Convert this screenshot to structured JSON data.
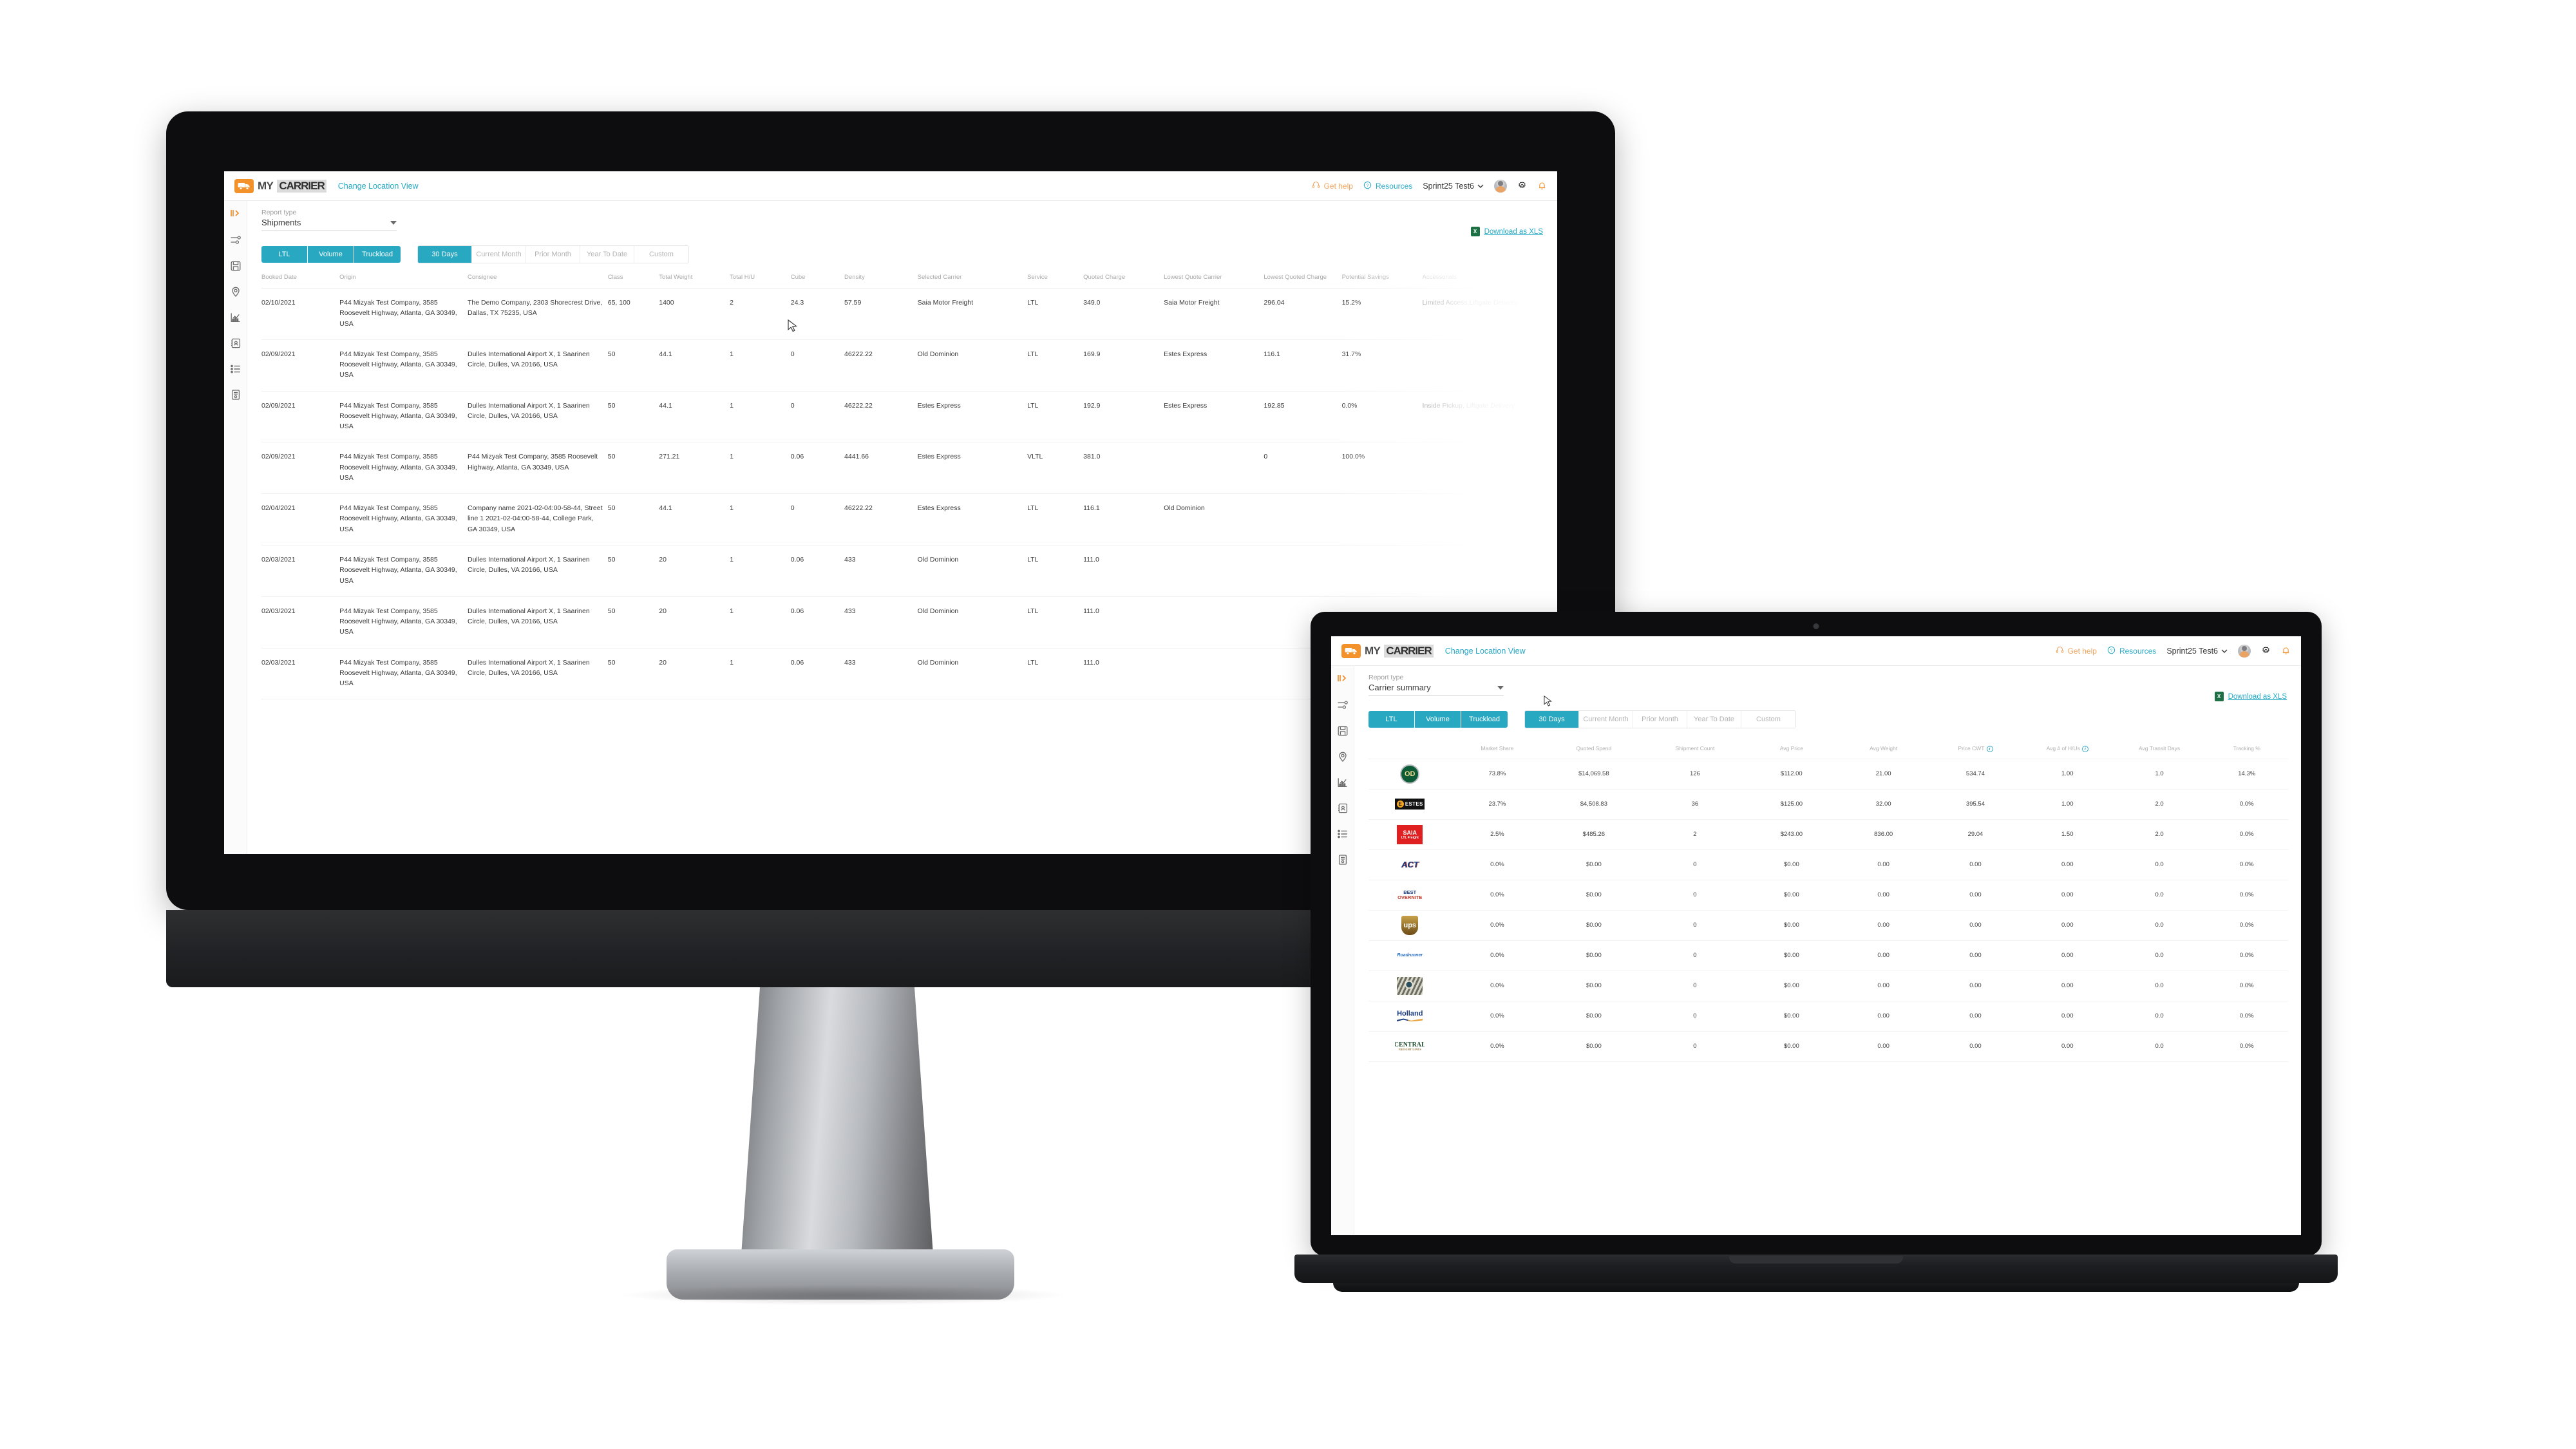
{
  "brand": {
    "my": "MY",
    "carrier": "CARRIER",
    "truck_icon": "truck-icon"
  },
  "topbar": {
    "change_location": "Change Location View",
    "get_help": "Get help",
    "resources": "Resources",
    "user": "Sprint25 Test6",
    "icons": [
      "headset-icon",
      "question-bubble-icon",
      "chevron-down-icon",
      "avatar",
      "gear-icon",
      "bell-icon"
    ]
  },
  "sidebar": {
    "items": [
      {
        "name": "expand-panel-icon",
        "glyph": "expand"
      },
      {
        "name": "filters-sliders-icon",
        "glyph": "sliders"
      },
      {
        "name": "save-disk-icon",
        "glyph": "disk"
      },
      {
        "name": "location-pin-icon",
        "glyph": "pin"
      },
      {
        "name": "analytics-chart-icon",
        "glyph": "chart"
      },
      {
        "name": "address-book-icon",
        "glyph": "book"
      },
      {
        "name": "list-icon",
        "glyph": "list"
      },
      {
        "name": "document-icon",
        "glyph": "doc"
      }
    ]
  },
  "desktop": {
    "report_type_label": "Report type",
    "report_type_value": "Shipments",
    "download_label": "Download as XLS",
    "download_icon": "xls-icon",
    "mode_tabs": [
      "LTL",
      "Volume",
      "Truckload"
    ],
    "range_tabs": [
      {
        "label": "30 Days",
        "active": true
      },
      {
        "label": "Current Month",
        "active": false
      },
      {
        "label": "Prior Month",
        "active": false
      },
      {
        "label": "Year To Date",
        "active": false
      },
      {
        "label": "Custom",
        "active": false
      }
    ],
    "columns": [
      "Booked Date",
      "Origin",
      "Consignee",
      "Class",
      "Total Weight",
      "Total H/U",
      "Cube",
      "Density",
      "Selected Carrier",
      "Service",
      "Quoted Charge",
      "Lowest Quote Carrier",
      "Lowest Quoted Charge",
      "Potential Savings",
      "Accessorials"
    ],
    "rows": [
      {
        "booked_date": "02/10/2021",
        "origin": "P44 Mizyak Test Company, 3585 Roosevelt Highway, Atlanta, GA 30349, USA",
        "consignee": "The Demo Company, 2303 Shorecrest Drive, Dallas, TX 75235, USA",
        "class": "65, 100",
        "total_weight": "1400",
        "total_hu": "2",
        "cube": "24.3",
        "density": "57.59",
        "selected_carrier": "Saia Motor Freight",
        "service": "LTL",
        "quoted_charge": "349.0",
        "lowest_quote_carrier": "Saia Motor Freight",
        "lowest_quoted_charge": "296.04",
        "potential_savings": "15.2%",
        "accessorials": "Limited Access,Liftgate Delivery"
      },
      {
        "booked_date": "02/09/2021",
        "origin": "P44 Mizyak Test Company, 3585 Roosevelt Highway, Atlanta, GA 30349, USA",
        "consignee": "Dulles International Airport X, 1 Saarinen Circle, Dulles, VA 20166, USA",
        "class": "50",
        "total_weight": "44.1",
        "total_hu": "1",
        "cube": "0",
        "density": "46222.22",
        "selected_carrier": "Old Dominion",
        "service": "LTL",
        "quoted_charge": "169.9",
        "lowest_quote_carrier": "Estes Express",
        "lowest_quoted_charge": "116.1",
        "potential_savings": "31.7%",
        "accessorials": ""
      },
      {
        "booked_date": "02/09/2021",
        "origin": "P44 Mizyak Test Company, 3585 Roosevelt Highway, Atlanta, GA 30349, USA",
        "consignee": "Dulles International Airport X, 1 Saarinen Circle, Dulles, VA 20166, USA",
        "class": "50",
        "total_weight": "44.1",
        "total_hu": "1",
        "cube": "0",
        "density": "46222.22",
        "selected_carrier": "Estes Express",
        "service": "LTL",
        "quoted_charge": "192.9",
        "lowest_quote_carrier": "Estes Express",
        "lowest_quoted_charge": "192.85",
        "potential_savings": "0.0%",
        "accessorials": "Inside Pickup, Liftgate Delivery"
      },
      {
        "booked_date": "02/09/2021",
        "origin": "P44 Mizyak Test Company, 3585 Roosevelt Highway, Atlanta, GA 30349, USA",
        "consignee": "P44 Mizyak Test Company, 3585 Roosevelt Highway, Atlanta, GA 30349, USA",
        "class": "50",
        "total_weight": "271.21",
        "total_hu": "1",
        "cube": "0.06",
        "density": "4441.66",
        "selected_carrier": "Estes Express",
        "service": "VLTL",
        "quoted_charge": "381.0",
        "lowest_quote_carrier": "",
        "lowest_quoted_charge": "0",
        "potential_savings": "100.0%",
        "accessorials": ""
      },
      {
        "booked_date": "02/04/2021",
        "origin": "P44 Mizyak Test Company, 3585 Roosevelt Highway, Atlanta, GA 30349, USA",
        "consignee": "Company name 2021-02-04:00-58-44, Street line 1 2021-02-04:00-58-44, College Park, GA 30349, USA",
        "class": "50",
        "total_weight": "44.1",
        "total_hu": "1",
        "cube": "0",
        "density": "46222.22",
        "selected_carrier": "Estes Express",
        "service": "LTL",
        "quoted_charge": "116.1",
        "lowest_quote_carrier": "Old Dominion",
        "lowest_quoted_charge": "",
        "potential_savings": "",
        "accessorials": ""
      },
      {
        "booked_date": "02/03/2021",
        "origin": "P44 Mizyak Test Company, 3585 Roosevelt Highway, Atlanta, GA 30349, USA",
        "consignee": "Dulles International Airport X, 1 Saarinen Circle, Dulles, VA 20166, USA",
        "class": "50",
        "total_weight": "20",
        "total_hu": "1",
        "cube": "0.06",
        "density": "433",
        "selected_carrier": "Old Dominion",
        "service": "LTL",
        "quoted_charge": "111.0",
        "lowest_quote_carrier": "",
        "lowest_quoted_charge": "",
        "potential_savings": "",
        "accessorials": ""
      },
      {
        "booked_date": "02/03/2021",
        "origin": "P44 Mizyak Test Company, 3585 Roosevelt Highway, Atlanta, GA 30349, USA",
        "consignee": "Dulles International Airport X, 1 Saarinen Circle, Dulles, VA 20166, USA",
        "class": "50",
        "total_weight": "20",
        "total_hu": "1",
        "cube": "0.06",
        "density": "433",
        "selected_carrier": "Old Dominion",
        "service": "LTL",
        "quoted_charge": "111.0",
        "lowest_quote_carrier": "",
        "lowest_quoted_charge": "",
        "potential_savings": "",
        "accessorials": ""
      },
      {
        "booked_date": "02/03/2021",
        "origin": "P44 Mizyak Test Company, 3585 Roosevelt Highway, Atlanta, GA 30349, USA",
        "consignee": "Dulles International Airport X, 1 Saarinen Circle, Dulles, VA 20166, USA",
        "class": "50",
        "total_weight": "20",
        "total_hu": "1",
        "cube": "0.06",
        "density": "433",
        "selected_carrier": "Old Dominion",
        "service": "LTL",
        "quoted_charge": "111.0",
        "lowest_quote_carrier": "",
        "lowest_quoted_charge": "",
        "potential_savings": "",
        "accessorials": ""
      }
    ]
  },
  "laptop": {
    "report_type_label": "Report type",
    "report_type_value": "Carrier summary",
    "download_label": "Download as XLS",
    "mode_tabs": [
      "LTL",
      "Volume",
      "Truckload"
    ],
    "range_tabs": [
      {
        "label": "30 Days",
        "active": true
      },
      {
        "label": "Current Month",
        "active": false
      },
      {
        "label": "Prior Month",
        "active": false
      },
      {
        "label": "Year To Date",
        "active": false
      },
      {
        "label": "Custom",
        "active": false
      }
    ],
    "columns": [
      {
        "label": "",
        "info": false
      },
      {
        "label": "Market Share",
        "info": false
      },
      {
        "label": "Quoted Spend",
        "info": false
      },
      {
        "label": "Shipment Count",
        "info": false
      },
      {
        "label": "Avg Price",
        "info": false
      },
      {
        "label": "Avg Weight",
        "info": false
      },
      {
        "label": "Price CWT",
        "info": true
      },
      {
        "label": "Avg # of H/Us",
        "info": true
      },
      {
        "label": "Avg Transit Days",
        "info": false
      },
      {
        "label": "Tracking %",
        "info": false
      }
    ],
    "rows": [
      {
        "logo": "old-dominion-logo",
        "market_share": "73.8%",
        "quoted_spend": "$14,069.58",
        "shipment_count": "126",
        "avg_price": "$112.00",
        "avg_weight": "21.00",
        "price_cwt": "534.74",
        "avg_hu": "1.00",
        "avg_transit_days": "1.0",
        "tracking_pct": "14.3%"
      },
      {
        "logo": "estes-logo",
        "market_share": "23.7%",
        "quoted_spend": "$4,508.83",
        "shipment_count": "36",
        "avg_price": "$125.00",
        "avg_weight": "32.00",
        "price_cwt": "395.54",
        "avg_hu": "1.00",
        "avg_transit_days": "2.0",
        "tracking_pct": "0.0%"
      },
      {
        "logo": "saia-logo",
        "market_share": "2.5%",
        "quoted_spend": "$485.26",
        "shipment_count": "2",
        "avg_price": "$243.00",
        "avg_weight": "836.00",
        "price_cwt": "29.04",
        "avg_hu": "1.50",
        "avg_transit_days": "2.0",
        "tracking_pct": "0.0%"
      },
      {
        "logo": "act-logo",
        "market_share": "0.0%",
        "quoted_spend": "$0.00",
        "shipment_count": "0",
        "avg_price": "$0.00",
        "avg_weight": "0.00",
        "price_cwt": "0.00",
        "avg_hu": "0.00",
        "avg_transit_days": "0.0",
        "tracking_pct": "0.0%"
      },
      {
        "logo": "best-overnite-logo",
        "market_share": "0.0%",
        "quoted_spend": "$0.00",
        "shipment_count": "0",
        "avg_price": "$0.00",
        "avg_weight": "0.00",
        "price_cwt": "0.00",
        "avg_hu": "0.00",
        "avg_transit_days": "0.0",
        "tracking_pct": "0.0%"
      },
      {
        "logo": "ups-logo",
        "market_share": "0.0%",
        "quoted_spend": "$0.00",
        "shipment_count": "0",
        "avg_price": "$0.00",
        "avg_weight": "0.00",
        "price_cwt": "0.00",
        "avg_hu": "0.00",
        "avg_transit_days": "0.0",
        "tracking_pct": "0.0%"
      },
      {
        "logo": "roadrunner-logo",
        "market_share": "0.0%",
        "quoted_spend": "$0.00",
        "shipment_count": "0",
        "avg_price": "$0.00",
        "avg_weight": "0.00",
        "price_cwt": "0.00",
        "avg_hu": "0.00",
        "avg_transit_days": "0.0",
        "tracking_pct": "0.0%"
      },
      {
        "logo": "peacock-logo",
        "market_share": "0.0%",
        "quoted_spend": "$0.00",
        "shipment_count": "0",
        "avg_price": "$0.00",
        "avg_weight": "0.00",
        "price_cwt": "0.00",
        "avg_hu": "0.00",
        "avg_transit_days": "0.0",
        "tracking_pct": "0.0%"
      },
      {
        "logo": "holland-logo",
        "market_share": "0.0%",
        "quoted_spend": "$0.00",
        "shipment_count": "0",
        "avg_price": "$0.00",
        "avg_weight": "0.00",
        "price_cwt": "0.00",
        "avg_hu": "0.00",
        "avg_transit_days": "0.0",
        "tracking_pct": "0.0%"
      },
      {
        "logo": "central-freight-logo",
        "market_share": "0.0%",
        "quoted_spend": "$0.00",
        "shipment_count": "0",
        "avg_price": "$0.00",
        "avg_weight": "0.00",
        "price_cwt": "0.00",
        "avg_hu": "0.00",
        "avg_transit_days": "0.0",
        "tracking_pct": "0.0%"
      }
    ]
  },
  "colors": {
    "accent_teal": "#29a8c2",
    "brand_orange": "#f3922b",
    "link_teal": "#28a9c4",
    "help_orange": "#eda45f"
  }
}
